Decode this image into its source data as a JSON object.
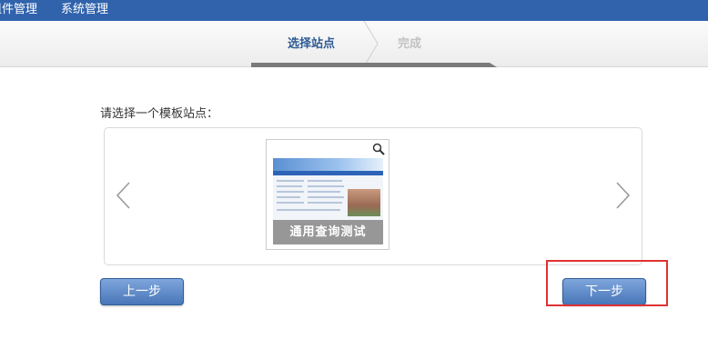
{
  "topnav": {
    "items": [
      "组件管理",
      "系统管理"
    ]
  },
  "steps": [
    {
      "label": "选择站点",
      "active": true
    },
    {
      "label": "完成",
      "active": false
    }
  ],
  "prompt": "请选择一个模板站点：",
  "template": {
    "caption": "通用查询测试"
  },
  "buttons": {
    "prev": "上一步",
    "next": "下一步"
  },
  "colors": {
    "nav_bg": "#3163ad",
    "step_active": "#2e5a94",
    "button": "#5a86c6",
    "highlight": "#e03232"
  }
}
